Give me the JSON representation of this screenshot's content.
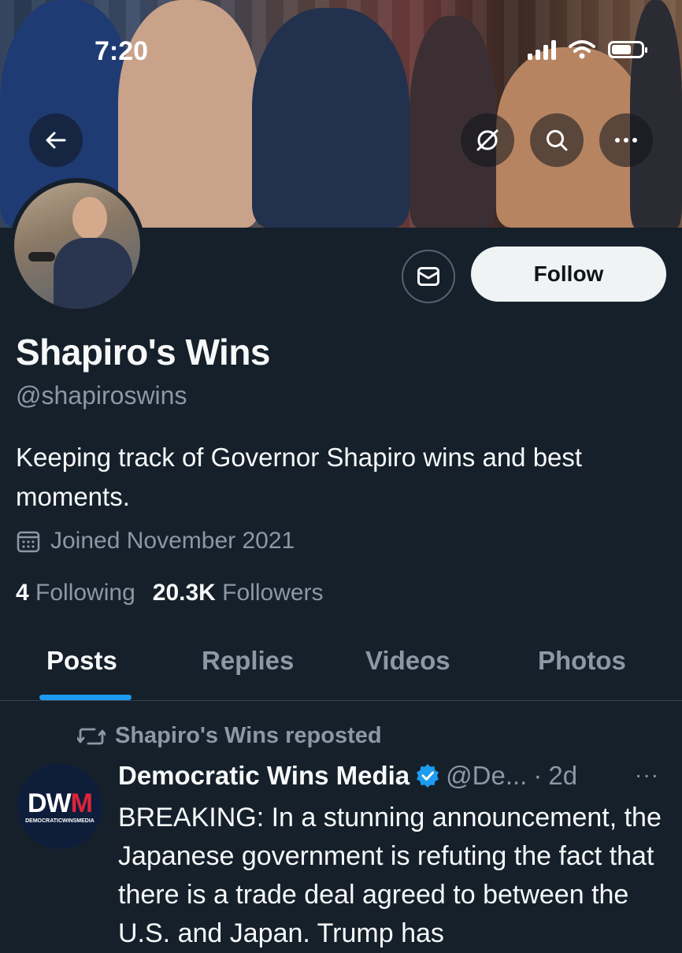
{
  "status_bar": {
    "time": "7:20",
    "icons": [
      "signal-icon",
      "wifi-icon",
      "battery-icon"
    ]
  },
  "header": {
    "back_icon": "back-arrow-icon",
    "actions": [
      "translate-off-icon",
      "search-icon",
      "more-icon"
    ]
  },
  "profile": {
    "name": "Shapiro's Wins",
    "handle": "@shapiroswins",
    "bio": "Keeping track of Governor Shapiro wins and best moments.",
    "joined": "Joined November 2021",
    "following_count": "4",
    "following_label": "Following",
    "followers_count": "20.3K",
    "followers_label": "Followers",
    "follow_label": "Follow",
    "message_icon": "mail-icon"
  },
  "tabs": [
    {
      "label": "Posts",
      "active": true
    },
    {
      "label": "Replies",
      "active": false
    },
    {
      "label": "Videos",
      "active": false
    },
    {
      "label": "Photos",
      "active": false
    }
  ],
  "post": {
    "repost_label": "Shapiro's Wins reposted",
    "avatar_logo": "DWM",
    "avatar_sub": "DEMOCRATICWINSMEDIA",
    "author": "Democratic Wins Media",
    "handle_truncated": "@De...",
    "separator": "·",
    "time": "2d",
    "more": "···",
    "text": "BREAKING: In a stunning announcement, the Japanese government is refuting the fact that there is a trade deal agreed to between the U.S. and Japan. Trump has"
  },
  "colors": {
    "background": "#15202b",
    "accent": "#1d9bf0",
    "muted": "#8b98a5",
    "verified": "#1d9bf0"
  }
}
